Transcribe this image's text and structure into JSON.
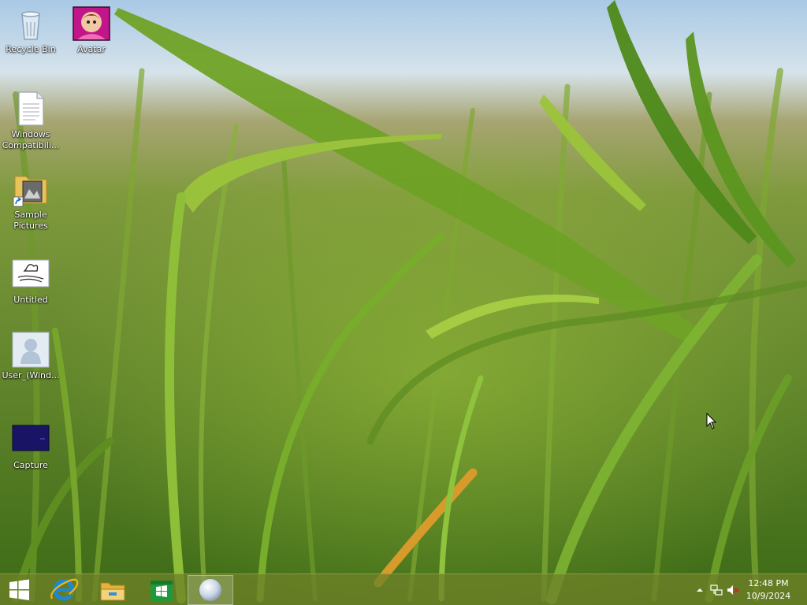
{
  "desktop": {
    "icons": [
      {
        "label": "Recycle Bin",
        "icon": "recycle-bin-icon"
      },
      {
        "label": "Avatar",
        "icon": "avatar-image-icon"
      },
      {
        "label": "Windows\nCompatibili...",
        "icon": "text-document-icon"
      },
      {
        "label": "Sample\nPictures",
        "icon": "folder-shortcut-icon"
      },
      {
        "label": "Untitled",
        "icon": "drawing-image-icon"
      },
      {
        "label": "User_(Wind...",
        "icon": "user-account-icon"
      },
      {
        "label": "Capture",
        "icon": "capture-image-icon"
      }
    ]
  },
  "taskbar": {
    "start": {
      "icon": "windows-start-icon"
    },
    "pinned": [
      {
        "icon": "internet-explorer-icon"
      },
      {
        "icon": "file-explorer-icon"
      },
      {
        "icon": "windows-store-icon"
      },
      {
        "icon": "sphere-app-icon"
      }
    ],
    "tray": {
      "icons": [
        "show-hidden-icons-arrow",
        "network-icon",
        "volume-muted-icon"
      ],
      "time": "12:48 PM",
      "date": "10/9/2024"
    }
  },
  "colors": {
    "taskbar": "#6e8228",
    "sky": "#b7d4ea",
    "grass": "#5f8d22",
    "ie_blue": "#1e88d8",
    "store_green": "#1f9a3a",
    "muted_red": "#e02020"
  }
}
